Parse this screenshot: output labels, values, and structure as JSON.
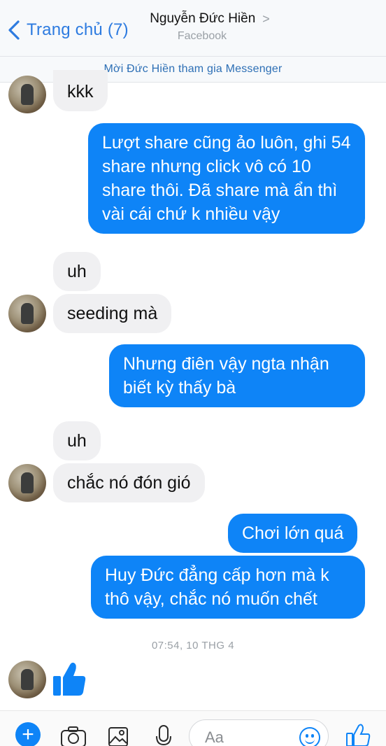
{
  "header": {
    "back_label": "Trang chủ (7)",
    "contact_name": "Nguyễn Đức Hiền",
    "contact_source": "Facebook",
    "invite_text": "Mời Đức Hiền tham gia Messenger"
  },
  "messages": [
    {
      "from": "them",
      "text": "kkk"
    },
    {
      "from": "me",
      "text": "Lượt share cũng ảo luôn, ghi 54 share nhưng click vô có 10 share thôi. Đã share mà ẩn thì vài cái chứ k nhiều vậy"
    },
    {
      "from": "them",
      "text": "uh"
    },
    {
      "from": "them",
      "text": "seeding mà"
    },
    {
      "from": "me",
      "text": "Nhưng điên vậy ngta nhận biết kỳ thấy bà"
    },
    {
      "from": "them",
      "text": "uh"
    },
    {
      "from": "them",
      "text": "chắc nó đón gió"
    },
    {
      "from": "me",
      "text": "Chơi lớn quá"
    },
    {
      "from": "me",
      "text": "Huy Đức đẳng cấp hơn mà k thô vậy, chắc nó muốn chết"
    }
  ],
  "timestamp": "07:54, 10 THG 4",
  "last_message": {
    "from": "them",
    "type": "like-sticker"
  },
  "composer": {
    "placeholder": "Aa",
    "icons": [
      "plus-icon",
      "camera-icon",
      "gallery-icon",
      "microphone-icon",
      "emoji-icon",
      "thumbs-up-icon"
    ]
  },
  "colors": {
    "accent": "#0e84f7",
    "incoming_bubble": "#f0f0f2",
    "link": "#2d7be0"
  }
}
